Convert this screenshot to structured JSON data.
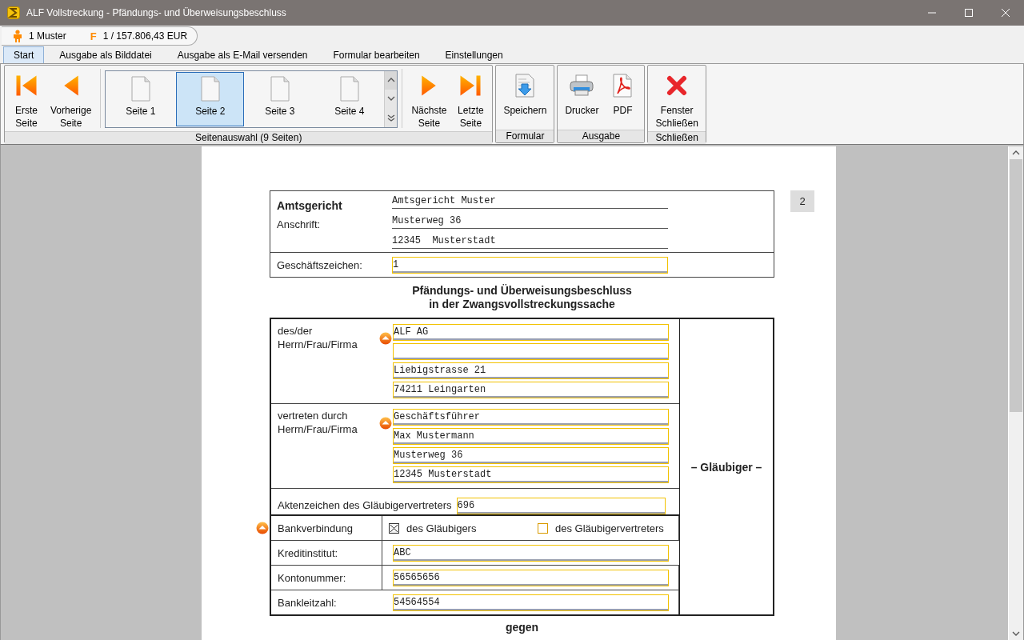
{
  "window": {
    "title": "ALF Vollstreckung - Pfändungs- und Überweisungsbeschluss"
  },
  "info_bar": {
    "debtor": "1 Muster",
    "claim_icon": "F",
    "claim": "1 / 157.806,43 EUR"
  },
  "tabs": [
    {
      "label": "Start",
      "selected": true
    },
    {
      "label": "Ausgabe als Bilddatei",
      "selected": false
    },
    {
      "label": "Ausgabe als E-Mail versenden",
      "selected": false
    },
    {
      "label": "Formular bearbeiten",
      "selected": false
    },
    {
      "label": "Einstellungen",
      "selected": false
    }
  ],
  "ribbon": {
    "groups": [
      {
        "label": "Seitenauswahl (9 Seiten)",
        "items": [
          {
            "kind": "first",
            "label": "Erste\nSeite"
          },
          {
            "kind": "prev",
            "label": "Vorherige\nSeite"
          },
          {
            "kind": "pages",
            "pages": [
              {
                "label": "Seite 1",
                "selected": false
              },
              {
                "label": "Seite 2",
                "selected": true
              },
              {
                "label": "Seite 3",
                "selected": false
              },
              {
                "label": "Seite 4",
                "selected": false
              }
            ]
          },
          {
            "kind": "next",
            "label": "Nächste\nSeite"
          },
          {
            "kind": "last",
            "label": "Letzte\nSeite"
          }
        ]
      },
      {
        "label": "Formular",
        "items": [
          {
            "kind": "save",
            "label": "Speichern"
          }
        ]
      },
      {
        "label": "Ausgabe",
        "items": [
          {
            "kind": "print",
            "label": "Drucker"
          },
          {
            "kind": "pdf",
            "label": "PDF"
          }
        ]
      },
      {
        "label": "Schließen",
        "items": [
          {
            "kind": "close",
            "label": "Fenster\nSchließen"
          }
        ]
      }
    ]
  },
  "document": {
    "page_number": "2",
    "court": {
      "heading": "Amtsgericht",
      "address_label": "Anschrift:",
      "lines": [
        "Amtsgericht Muster",
        "Musterweg 36",
        "12345  Musterstadt"
      ]
    },
    "reference": {
      "label": "Geschäftszeichen:",
      "value": "1"
    },
    "title": [
      "Pfändungs- und Überweisungsbeschluss",
      "in der Zwangsvollstreckungssache"
    ],
    "creditor": {
      "side_label": "– Gläubiger –",
      "sections": [
        {
          "label": "des/der\nHerrn/Frau/Firma",
          "fields": [
            {
              "kind": "text",
              "value": "ALF AG"
            },
            {
              "kind": "text"
            },
            {
              "kind": "text",
              "value": "Liebigstrasse 21"
            },
            {
              "kind": "text",
              "value": "74211 Leingarten"
            }
          ]
        },
        {
          "label": "vertreten durch\nHerrn/Frau/Firma",
          "fields": [
            {
              "kind": "text",
              "value": "Geschäftsführer"
            },
            {
              "kind": "text",
              "value": "Max Mustermann"
            },
            {
              "kind": "text",
              "value": "Musterweg 36"
            },
            {
              "kind": "text",
              "value": "12345 Musterstadt"
            }
          ]
        }
      ],
      "representative_ref": {
        "label": "Aktenzeichen des Gläubigervertreters",
        "value": "696"
      },
      "bank": {
        "label": "Bankverbindung",
        "options": [
          {
            "label": "des Gläubigers",
            "checked": true
          },
          {
            "label": "des Gläubigervertreters",
            "checked": false
          }
        ],
        "fields": [
          {
            "label": "Kreditinstitut:",
            "value": "ABC"
          },
          {
            "label": "Kontonummer:",
            "value": "56565656"
          },
          {
            "label": "Bankleitzahl:",
            "value": "54564554"
          }
        ]
      }
    },
    "footer": "gegen"
  }
}
